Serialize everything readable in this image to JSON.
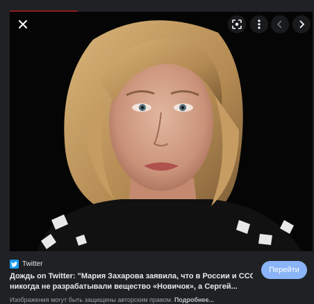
{
  "viewer": {
    "image_alt": "Portrait photo",
    "controls": {
      "close_icon": "close-icon",
      "lens_icon": "lens-icon",
      "more_icon": "more-vertical-icon",
      "prev_icon": "chevron-left-icon",
      "next_icon": "chevron-right-icon"
    }
  },
  "result": {
    "source_name": "Twitter",
    "source_icon": "twitter-bird-icon",
    "title_line1": "Дождь on Twitter: \"Мария Захарова заявила, что в России и СССР",
    "title_line2": "никогда не разрабатывали вещество «Новичок», а Сергей...",
    "visit_label": "Перейти",
    "copyright_text": "Изображения могут быть защищены авторским правом. ",
    "more_link": "Подробнее..."
  },
  "colors": {
    "background": "#202124",
    "visit_button": "#8ab4f8",
    "twitter_blue": "#1d9bf0",
    "accent_line": "#8c1d1d"
  }
}
